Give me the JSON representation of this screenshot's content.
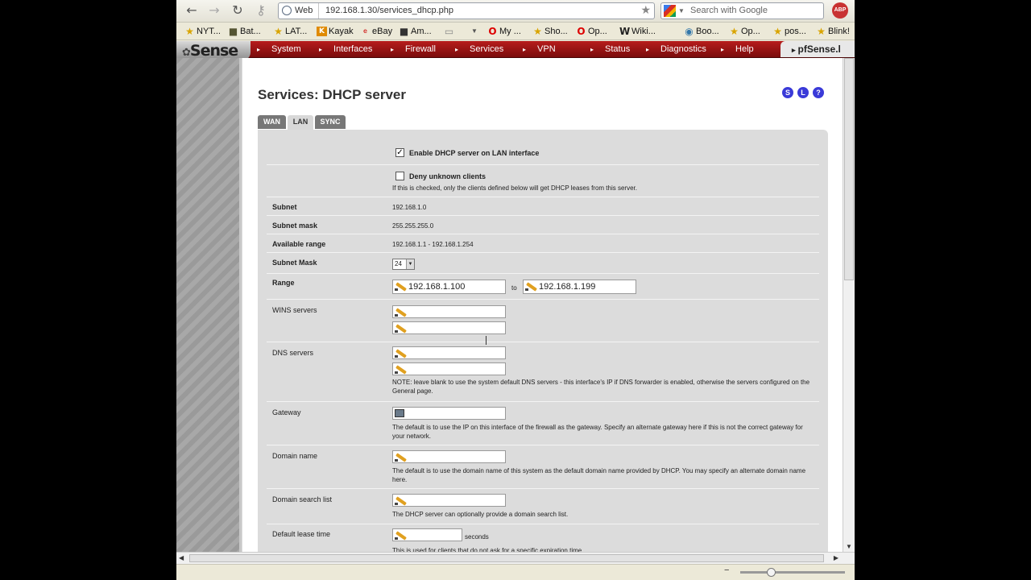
{
  "browser": {
    "address_label": "Web",
    "url": "192.168.1.30/services_dhcp.php",
    "search_placeholder": "Search with Google",
    "adblock_label": "ABP",
    "bookmarks": [
      "NYT...",
      "Bat...",
      "LAT...",
      "Kayak",
      "eBay",
      "Am...",
      "",
      "My ...",
      "Sho...",
      "Op...",
      "Wiki...",
      "Boo...",
      "Op...",
      "pos...",
      "Blink!"
    ]
  },
  "pfsense": {
    "logo": "Sense",
    "nav": [
      "System",
      "Interfaces",
      "Firewall",
      "Services",
      "VPN",
      "Status",
      "Diagnostics",
      "Help"
    ],
    "tab_title": "pfSense.l"
  },
  "page": {
    "title": "Services: DHCP server",
    "help_icons": [
      "S",
      "L",
      "?"
    ],
    "tabs": [
      "WAN",
      "LAN",
      "SYNC"
    ],
    "active_tab": "LAN"
  },
  "form": {
    "enable_label": "Enable DHCP server on LAN interface",
    "enable_checked": true,
    "deny_label": "Deny unknown clients",
    "deny_checked": false,
    "deny_note": "If this is checked, only the clients defined below will get DHCP leases from this server.",
    "subnet_label": "Subnet",
    "subnet_value": "192.168.1.0",
    "subnet_mask_label": "Subnet mask",
    "subnet_mask_value": "255.255.255.0",
    "available_range_label": "Available range",
    "available_range_value": "192.168.1.1 - 192.168.1.254",
    "subnet_mask_sel_label": "Subnet Mask",
    "subnet_mask_sel_value": "24",
    "range_label": "Range",
    "range_from": "192.168.1.100",
    "range_to_label": "to",
    "range_to": "192.168.1.199",
    "wins_label": "WINS servers",
    "dns_label": "DNS servers",
    "dns_note": "NOTE: leave blank to use the system default DNS servers - this interface's IP if DNS forwarder is enabled, otherwise the servers configured on the General page.",
    "gateway_label": "Gateway",
    "gateway_note": "The default is to use the IP on this interface of the firewall as the gateway. Specify an alternate gateway here if this is not the correct gateway for your network.",
    "domain_label": "Domain name",
    "domain_note": "The default is to use the domain name of this system as the default domain name provided by DHCP. You may specify an alternate domain name here.",
    "domain_search_label": "Domain search list",
    "domain_search_note": "The DHCP server can optionally provide a domain search list.",
    "lease_label": "Default lease time",
    "lease_unit": "seconds",
    "lease_note": "This is used for clients that do not ask for a specific expiration time."
  }
}
